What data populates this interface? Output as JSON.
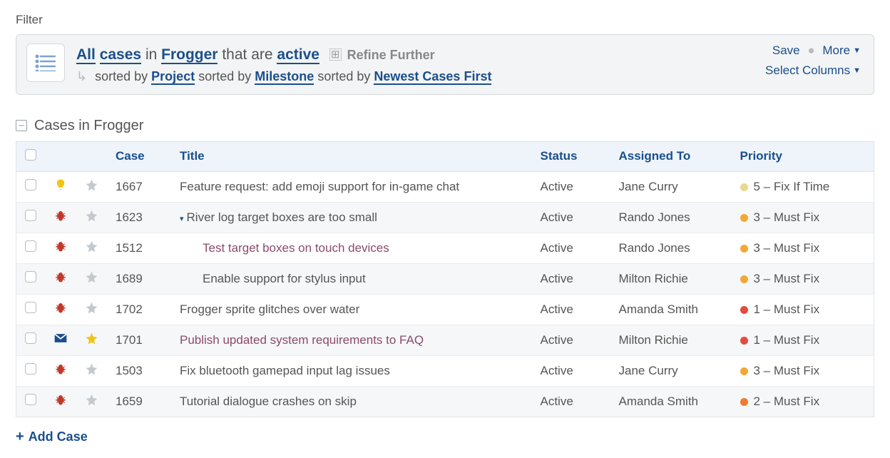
{
  "filter_label": "Filter",
  "filter": {
    "all": "All",
    "cases": "cases",
    "in": "in",
    "project": "Frogger",
    "that_are": "that are",
    "status": "active",
    "refine": "Refine Further",
    "sorted_by": "sorted by",
    "sort1": "Project",
    "sort2": "Milestone",
    "sort3": "Newest Cases First"
  },
  "actions": {
    "save": "Save",
    "more": "More",
    "select_columns": "Select Columns"
  },
  "group_title": "Cases in Frogger",
  "columns": {
    "case": "Case",
    "title": "Title",
    "status": "Status",
    "assigned": "Assigned To",
    "priority": "Priority"
  },
  "rows": [
    {
      "id": "1667",
      "type": "bulb",
      "starred": false,
      "title": "Feature request: add emoji support for in-game chat",
      "visited": false,
      "indent": 0,
      "expandable": false,
      "status": "Active",
      "assignee": "Jane Curry",
      "priority": {
        "level": 5,
        "label": "5 – Fix If Time"
      }
    },
    {
      "id": "1623",
      "type": "bug",
      "starred": false,
      "title": "River log target boxes are too small",
      "visited": false,
      "indent": 0,
      "expandable": true,
      "status": "Active",
      "assignee": "Rando Jones",
      "priority": {
        "level": 3,
        "label": "3 – Must Fix"
      }
    },
    {
      "id": "1512",
      "type": "bug",
      "starred": false,
      "title": "Test target boxes on touch devices",
      "visited": true,
      "indent": 1,
      "expandable": false,
      "status": "Active",
      "assignee": "Rando Jones",
      "priority": {
        "level": 3,
        "label": "3 – Must Fix"
      }
    },
    {
      "id": "1689",
      "type": "bug",
      "starred": false,
      "title": "Enable support for stylus input",
      "visited": false,
      "indent": 1,
      "expandable": false,
      "status": "Active",
      "assignee": "Milton Richie",
      "priority": {
        "level": 3,
        "label": "3 – Must Fix"
      }
    },
    {
      "id": "1702",
      "type": "bug",
      "starred": false,
      "title": "Frogger sprite glitches over water",
      "visited": false,
      "indent": 0,
      "expandable": false,
      "status": "Active",
      "assignee": "Amanda Smith",
      "priority": {
        "level": 1,
        "label": "1 – Must Fix"
      }
    },
    {
      "id": "1701",
      "type": "mail",
      "starred": true,
      "title": "Publish updated system requirements to FAQ",
      "visited": true,
      "indent": 0,
      "expandable": false,
      "status": "Active",
      "assignee": "Milton Richie",
      "priority": {
        "level": 1,
        "label": "1 – Must Fix"
      }
    },
    {
      "id": "1503",
      "type": "bug",
      "starred": false,
      "title": "Fix bluetooth gamepad input lag issues",
      "visited": false,
      "indent": 0,
      "expandable": false,
      "status": "Active",
      "assignee": "Jane Curry",
      "priority": {
        "level": 3,
        "label": "3 – Must Fix"
      }
    },
    {
      "id": "1659",
      "type": "bug",
      "starred": false,
      "title": "Tutorial dialogue crashes on skip",
      "visited": false,
      "indent": 0,
      "expandable": false,
      "status": "Active",
      "assignee": "Amanda Smith",
      "priority": {
        "level": 2,
        "label": "2 – Must Fix"
      }
    }
  ],
  "add_case": "Add Case"
}
